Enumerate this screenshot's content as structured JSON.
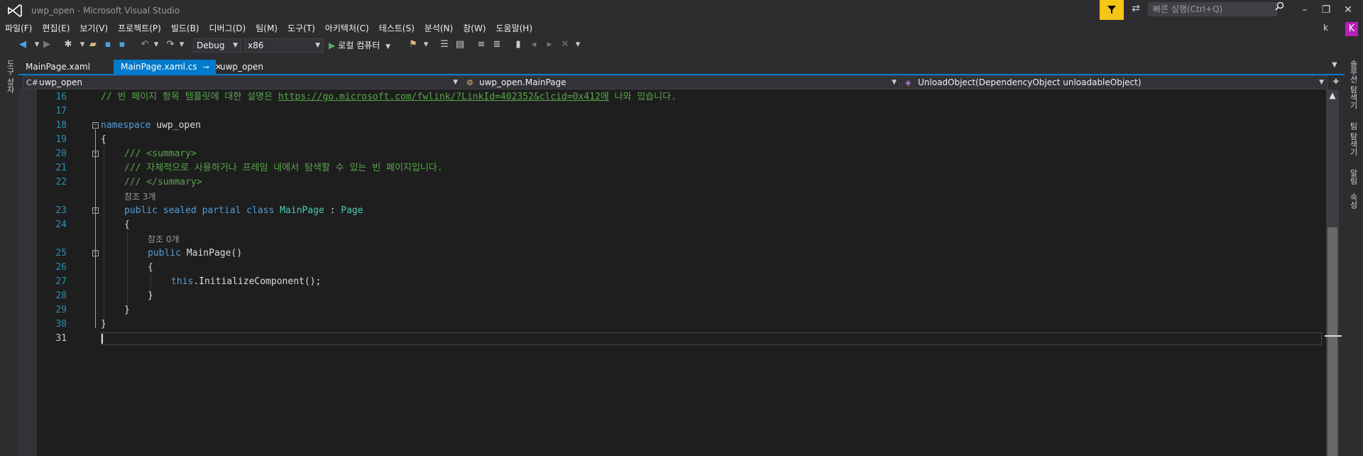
{
  "window": {
    "title": "uwp_open - Microsoft Visual Studio",
    "quick_launch_placeholder": "빠른 실행(Ctrl+Q)",
    "user_initial": "k",
    "avatar_letter": "K",
    "accent_color": "#007acc",
    "filter_color": "#f5c518",
    "avatar_color": "#b61fb8"
  },
  "menu": [
    "파일(F)",
    "편집(E)",
    "보기(V)",
    "프로젝트(P)",
    "빌드(B)",
    "디버그(D)",
    "팀(M)",
    "도구(T)",
    "아키텍처(C)",
    "테스트(S)",
    "분석(N)",
    "창(W)",
    "도움말(H)"
  ],
  "toolbar": {
    "configuration": "Debug",
    "platform": "x86",
    "run_target": "로컬 컴퓨터"
  },
  "left_strip": {
    "label": "도구 상자"
  },
  "right_strip": {
    "labels": [
      "솔루션 탐색기",
      "팀 탐색기",
      "알림",
      "속성"
    ]
  },
  "tabs": [
    {
      "label": "MainPage.xaml",
      "active": false
    },
    {
      "label": "MainPage.xaml.cs",
      "active": true
    },
    {
      "label": "uwp_open",
      "active": false
    }
  ],
  "navbar": {
    "project": "uwp_open",
    "class": "uwp_open.MainPage",
    "member": "UnloadObject(DependencyObject unloadableObject)"
  },
  "editor": {
    "line_numbers": [
      "16",
      "17",
      "18",
      "19",
      "20",
      "21",
      "22",
      "23",
      "24",
      "25",
      "26",
      "27",
      "28",
      "29",
      "30",
      "31"
    ],
    "current_line": "31",
    "codelens": [
      "참조 3개",
      "참조 0개"
    ],
    "lines": {
      "l16_comment": "// 빈 페이지 항목 템플릿에 대한 설명은 ",
      "l16_link": "https://go.microsoft.com/fwlink/?LinkId=402352&clcid=0x412에",
      "l16_tail": " 나와 있습니다.",
      "l18_kw": "namespace",
      "l18_name": " uwp_open",
      "l19": "{",
      "l20": "/// <summary>",
      "l21": "/// 자체적으로 사용하거나 프레임 내에서 탐색할 수 있는 빈 페이지입니다.",
      "l22": "/// </summary>",
      "l23_kw": "public sealed partial class",
      "l23_type": "MainPage",
      "l23_colon": " : ",
      "l23_base": "Page",
      "l24": "{",
      "l25_kw": "public",
      "l25_rest": " MainPage()",
      "l26": "{",
      "l27_kw": "this",
      "l27_rest": ".InitializeComponent();",
      "l28": "}",
      "l29": "}",
      "l30": "}"
    }
  }
}
